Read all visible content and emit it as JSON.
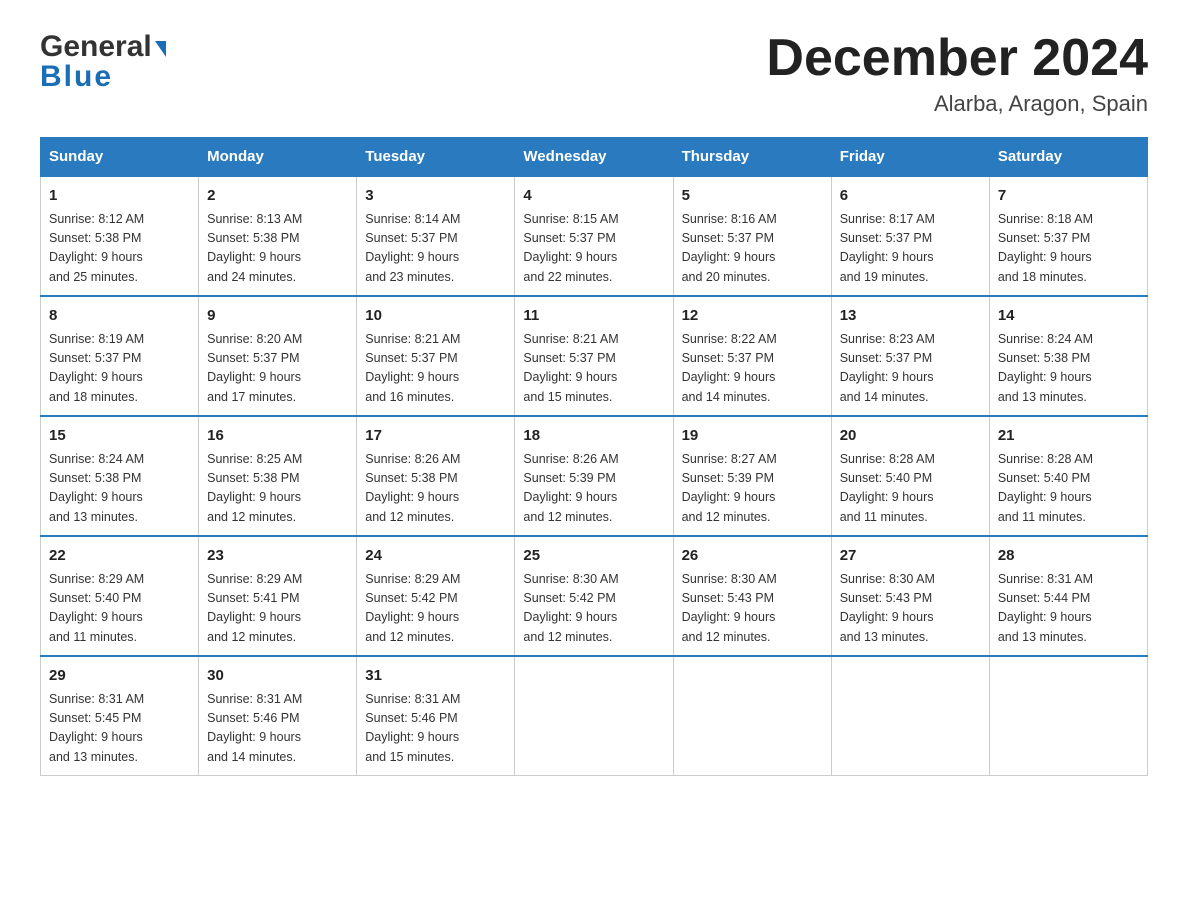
{
  "header": {
    "logo_general": "General",
    "logo_blue": "Blue",
    "month_year": "December 2024",
    "location": "Alarba, Aragon, Spain"
  },
  "days_of_week": [
    "Sunday",
    "Monday",
    "Tuesday",
    "Wednesday",
    "Thursday",
    "Friday",
    "Saturday"
  ],
  "weeks": [
    [
      {
        "day": "1",
        "sunrise": "8:12 AM",
        "sunset": "5:38 PM",
        "daylight": "9 hours and 25 minutes."
      },
      {
        "day": "2",
        "sunrise": "8:13 AM",
        "sunset": "5:38 PM",
        "daylight": "9 hours and 24 minutes."
      },
      {
        "day": "3",
        "sunrise": "8:14 AM",
        "sunset": "5:37 PM",
        "daylight": "9 hours and 23 minutes."
      },
      {
        "day": "4",
        "sunrise": "8:15 AM",
        "sunset": "5:37 PM",
        "daylight": "9 hours and 22 minutes."
      },
      {
        "day": "5",
        "sunrise": "8:16 AM",
        "sunset": "5:37 PM",
        "daylight": "9 hours and 20 minutes."
      },
      {
        "day": "6",
        "sunrise": "8:17 AM",
        "sunset": "5:37 PM",
        "daylight": "9 hours and 19 minutes."
      },
      {
        "day": "7",
        "sunrise": "8:18 AM",
        "sunset": "5:37 PM",
        "daylight": "9 hours and 18 minutes."
      }
    ],
    [
      {
        "day": "8",
        "sunrise": "8:19 AM",
        "sunset": "5:37 PM",
        "daylight": "9 hours and 18 minutes."
      },
      {
        "day": "9",
        "sunrise": "8:20 AM",
        "sunset": "5:37 PM",
        "daylight": "9 hours and 17 minutes."
      },
      {
        "day": "10",
        "sunrise": "8:21 AM",
        "sunset": "5:37 PM",
        "daylight": "9 hours and 16 minutes."
      },
      {
        "day": "11",
        "sunrise": "8:21 AM",
        "sunset": "5:37 PM",
        "daylight": "9 hours and 15 minutes."
      },
      {
        "day": "12",
        "sunrise": "8:22 AM",
        "sunset": "5:37 PM",
        "daylight": "9 hours and 14 minutes."
      },
      {
        "day": "13",
        "sunrise": "8:23 AM",
        "sunset": "5:37 PM",
        "daylight": "9 hours and 14 minutes."
      },
      {
        "day": "14",
        "sunrise": "8:24 AM",
        "sunset": "5:38 PM",
        "daylight": "9 hours and 13 minutes."
      }
    ],
    [
      {
        "day": "15",
        "sunrise": "8:24 AM",
        "sunset": "5:38 PM",
        "daylight": "9 hours and 13 minutes."
      },
      {
        "day": "16",
        "sunrise": "8:25 AM",
        "sunset": "5:38 PM",
        "daylight": "9 hours and 12 minutes."
      },
      {
        "day": "17",
        "sunrise": "8:26 AM",
        "sunset": "5:38 PM",
        "daylight": "9 hours and 12 minutes."
      },
      {
        "day": "18",
        "sunrise": "8:26 AM",
        "sunset": "5:39 PM",
        "daylight": "9 hours and 12 minutes."
      },
      {
        "day": "19",
        "sunrise": "8:27 AM",
        "sunset": "5:39 PM",
        "daylight": "9 hours and 12 minutes."
      },
      {
        "day": "20",
        "sunrise": "8:28 AM",
        "sunset": "5:40 PM",
        "daylight": "9 hours and 11 minutes."
      },
      {
        "day": "21",
        "sunrise": "8:28 AM",
        "sunset": "5:40 PM",
        "daylight": "9 hours and 11 minutes."
      }
    ],
    [
      {
        "day": "22",
        "sunrise": "8:29 AM",
        "sunset": "5:40 PM",
        "daylight": "9 hours and 11 minutes."
      },
      {
        "day": "23",
        "sunrise": "8:29 AM",
        "sunset": "5:41 PM",
        "daylight": "9 hours and 12 minutes."
      },
      {
        "day": "24",
        "sunrise": "8:29 AM",
        "sunset": "5:42 PM",
        "daylight": "9 hours and 12 minutes."
      },
      {
        "day": "25",
        "sunrise": "8:30 AM",
        "sunset": "5:42 PM",
        "daylight": "9 hours and 12 minutes."
      },
      {
        "day": "26",
        "sunrise": "8:30 AM",
        "sunset": "5:43 PM",
        "daylight": "9 hours and 12 minutes."
      },
      {
        "day": "27",
        "sunrise": "8:30 AM",
        "sunset": "5:43 PM",
        "daylight": "9 hours and 13 minutes."
      },
      {
        "day": "28",
        "sunrise": "8:31 AM",
        "sunset": "5:44 PM",
        "daylight": "9 hours and 13 minutes."
      }
    ],
    [
      {
        "day": "29",
        "sunrise": "8:31 AM",
        "sunset": "5:45 PM",
        "daylight": "9 hours and 13 minutes."
      },
      {
        "day": "30",
        "sunrise": "8:31 AM",
        "sunset": "5:46 PM",
        "daylight": "9 hours and 14 minutes."
      },
      {
        "day": "31",
        "sunrise": "8:31 AM",
        "sunset": "5:46 PM",
        "daylight": "9 hours and 15 minutes."
      },
      null,
      null,
      null,
      null
    ]
  ],
  "labels": {
    "sunrise": "Sunrise:",
    "sunset": "Sunset:",
    "daylight": "Daylight:"
  }
}
